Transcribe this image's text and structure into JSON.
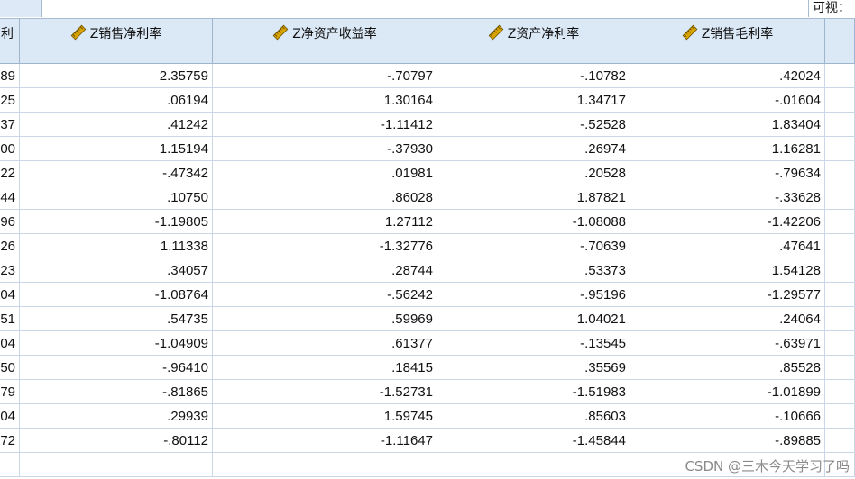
{
  "toolbar": {
    "visible_label": "可视："
  },
  "columns": [
    {
      "label": "利",
      "icon": ""
    },
    {
      "label": "Z销售净利率",
      "icon": "scale-ruler-icon"
    },
    {
      "label": "Z净资产收益率",
      "icon": "scale-ruler-icon"
    },
    {
      "label": "Z资产净利率",
      "icon": "scale-ruler-icon"
    },
    {
      "label": "Z销售毛利率",
      "icon": "scale-ruler-icon"
    },
    {
      "label": "",
      "icon": ""
    }
  ],
  "rows": [
    [
      "89",
      "2.35759",
      "-.70797",
      "-.10782",
      ".42024"
    ],
    [
      "25",
      ".06194",
      "1.30164",
      "1.34717",
      "-.01604"
    ],
    [
      "37",
      ".41242",
      "-1.11412",
      "-.52528",
      "1.83404"
    ],
    [
      "00",
      "1.15194",
      "-.37930",
      ".26974",
      "1.16281"
    ],
    [
      "22",
      "-.47342",
      ".01981",
      ".20528",
      "-.79634"
    ],
    [
      "44",
      ".10750",
      ".86028",
      "1.87821",
      "-.33628"
    ],
    [
      "96",
      "-1.19805",
      "1.27112",
      "-1.08088",
      "-1.42206"
    ],
    [
      "26",
      "1.11338",
      "-1.32776",
      "-.70639",
      ".47641"
    ],
    [
      "23",
      ".34057",
      ".28744",
      ".53373",
      "1.54128"
    ],
    [
      "04",
      "-1.08764",
      "-.56242",
      "-.95196",
      "-1.29577"
    ],
    [
      "51",
      ".54735",
      ".59969",
      "1.04021",
      ".24064"
    ],
    [
      "04",
      "-1.04909",
      ".61377",
      "-.13545",
      "-.63971"
    ],
    [
      "50",
      "-.96410",
      ".18415",
      ".35569",
      ".85528"
    ],
    [
      "79",
      "-.81865",
      "-1.52731",
      "-1.51983",
      "-1.01899"
    ],
    [
      "04",
      ".29939",
      "1.59745",
      ".85603",
      "-.10666"
    ],
    [
      "72",
      "-.80112",
      "-1.11647",
      "-1.45844",
      "-.89885"
    ],
    [
      "",
      "",
      "",
      "",
      ""
    ]
  ],
  "watermark": "CSDN @三木今天学习了吗",
  "colors": {
    "header_bg": "#dbe8f6",
    "grid_line": "#c9d6e6",
    "ruler_icon": "#d9a400"
  }
}
